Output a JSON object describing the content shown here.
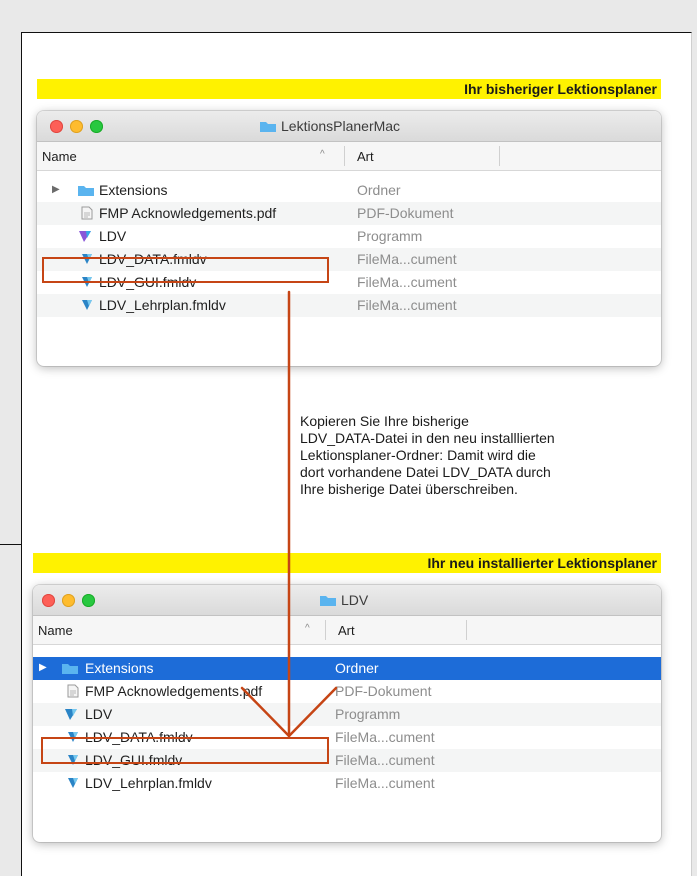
{
  "window1": {
    "banner": "Ihr bisheriger Lektionsplaner",
    "title": "LektionsPlanerMac",
    "col_name": "Name",
    "col_sort": "^",
    "col_kind": "Art",
    "rows": [
      {
        "name": "Extensions",
        "kind": "Ordner"
      },
      {
        "name": "FMP Acknowledgements.pdf",
        "kind": "PDF-Dokument"
      },
      {
        "name": "LDV",
        "kind": "Programm"
      },
      {
        "name": "LDV_DATA.fmldv",
        "kind": "FileMa...cument"
      },
      {
        "name": "LDV_GUI.fmldv",
        "kind": "FileMa...cument"
      },
      {
        "name": "LDV_Lehrplan.fmldv",
        "kind": "FileMa...cument"
      }
    ]
  },
  "instruction": "Kopieren Sie Ihre bisherige\nLDV_DATA-Datei in den neu installlierten\nLektionsplaner-Ordner: Damit wird die\ndort vorhandene Datei LDV_DATA durch\nIhre bisherige Datei überschreiben.",
  "window2": {
    "banner": "Ihr neu installierter Lektionsplaner",
    "title": "LDV",
    "col_name": "Name",
    "col_sort": "^",
    "col_kind": "Art",
    "rows": [
      {
        "name": "Extensions",
        "kind": "Ordner"
      },
      {
        "name": "FMP Acknowledgements.pdf",
        "kind": "PDF-Dokument"
      },
      {
        "name": "LDV",
        "kind": "Programm"
      },
      {
        "name": "LDV_DATA.fmldv",
        "kind": "FileMa...cument"
      },
      {
        "name": "LDV_GUI.fmldv",
        "kind": "FileMa...cument"
      },
      {
        "name": "LDV_Lehrplan.fmldv",
        "kind": "FileMa...cument"
      }
    ]
  },
  "colors": {
    "banner": "#fff200",
    "highlight": "#c64515",
    "selection": "#1d6cd8",
    "folder": "#5ab4ef"
  }
}
